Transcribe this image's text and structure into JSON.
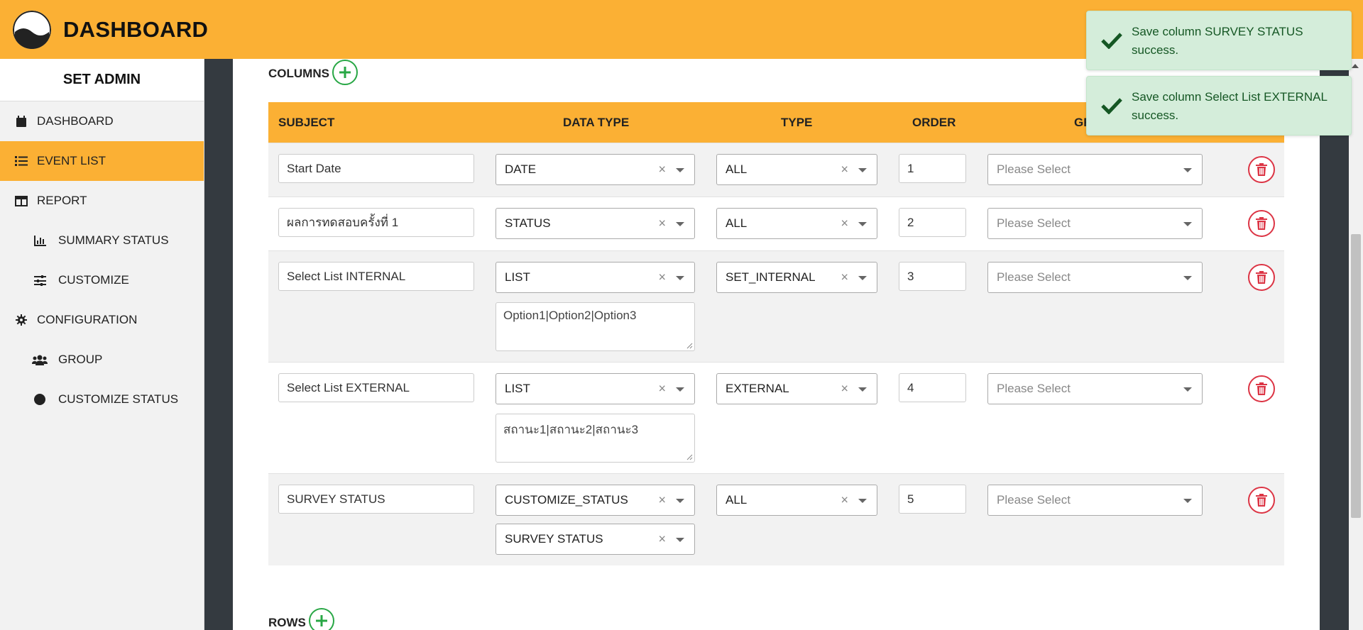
{
  "header": {
    "title": "DASHBOARD"
  },
  "sidebar": {
    "title": "SET ADMIN",
    "items": [
      {
        "label": "DASHBOARD",
        "icon": "calendar-icon"
      },
      {
        "label": "EVENT LIST",
        "icon": "list-icon",
        "active": true
      },
      {
        "label": "REPORT",
        "icon": "table-icon"
      },
      {
        "label": "SUMMARY STATUS",
        "icon": "bar-chart-icon"
      },
      {
        "label": "CUSTOMIZE",
        "icon": "sliders-icon"
      },
      {
        "label": "CONFIGURATION",
        "icon": "gear-icon"
      },
      {
        "label": "GROUP",
        "icon": "users-icon"
      },
      {
        "label": "CUSTOMIZE STATUS",
        "icon": "circle-icon"
      }
    ]
  },
  "columns_section": {
    "label": "COLUMNS",
    "headers": {
      "subject": "SUBJECT",
      "data_type": "DATA TYPE",
      "type": "TYPE",
      "order": "ORDER",
      "group": "GR"
    },
    "rows": [
      {
        "subject": "Start Date",
        "data_type": "DATE",
        "type": "ALL",
        "order": "1",
        "group": "Please Select"
      },
      {
        "subject": "ผลการทดสอบครั้งที่ 1",
        "data_type": "STATUS",
        "type": "ALL",
        "order": "2",
        "group": "Please Select"
      },
      {
        "subject": "Select List INTERNAL",
        "data_type": "LIST",
        "type": "SET_INTERNAL",
        "order": "3",
        "group": "Please Select",
        "options": "Option1|Option2|Option3"
      },
      {
        "subject": "Select List EXTERNAL",
        "data_type": "LIST",
        "type": "EXTERNAL",
        "order": "4",
        "group": "Please Select",
        "options": "สถานะ1|สถานะ2|สถานะ3"
      },
      {
        "subject": "SURVEY STATUS",
        "data_type": "CUSTOMIZE_STATUS",
        "type": "ALL",
        "order": "5",
        "group": "Please Select",
        "status": "SURVEY STATUS"
      }
    ]
  },
  "rows_section": {
    "label": "ROWS"
  },
  "toasts": [
    {
      "message": "Save column SURVEY STATUS success."
    },
    {
      "message": "Save column Select List EXTERNAL success."
    }
  ],
  "colors": {
    "brand": "#fbb034",
    "success": "#28a745",
    "danger": "#dc3545",
    "toast_bg": "#d4edda",
    "toast_text": "#155724"
  }
}
